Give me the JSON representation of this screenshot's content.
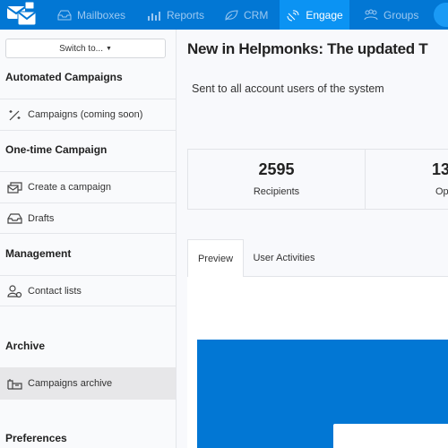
{
  "nav": {
    "items": [
      {
        "label": "Mailboxes",
        "icon": "inbox-icon"
      },
      {
        "label": "Reports",
        "icon": "bar-chart-icon"
      },
      {
        "label": "CRM",
        "icon": "leaf-icon"
      },
      {
        "label": "Engage",
        "icon": "satellite-icon",
        "active": true
      },
      {
        "label": "Groups",
        "icon": "users-icon"
      }
    ],
    "accent": "#0277d4",
    "active_color": "#0b93f3"
  },
  "sidebar": {
    "switch_label": "Switch to...",
    "sections": [
      "Automated Campaigns",
      "One-time Campaign",
      "Management",
      "Archive",
      "Preferences"
    ],
    "items": [
      {
        "label": "Campaigns (coming soon)",
        "icon": "magic-wand-icon"
      },
      {
        "label": "Create a campaign",
        "icon": "create-campaign-icon"
      },
      {
        "label": "Drafts",
        "icon": "inbox-icon"
      },
      {
        "label": "Contact lists",
        "icon": "contact-list-icon"
      },
      {
        "label": "Campaigns archive",
        "icon": "archive-icon",
        "selected": true
      }
    ]
  },
  "main": {
    "title": "New in Helpmonks: The updated T",
    "subtitle": "Sent to all account users of the system",
    "stats": [
      {
        "value": "2595",
        "label": "Recipients"
      },
      {
        "value": "13",
        "label": "Op"
      }
    ],
    "tabs": [
      {
        "label": "Preview",
        "active": true
      },
      {
        "label": "User Activities"
      }
    ]
  }
}
